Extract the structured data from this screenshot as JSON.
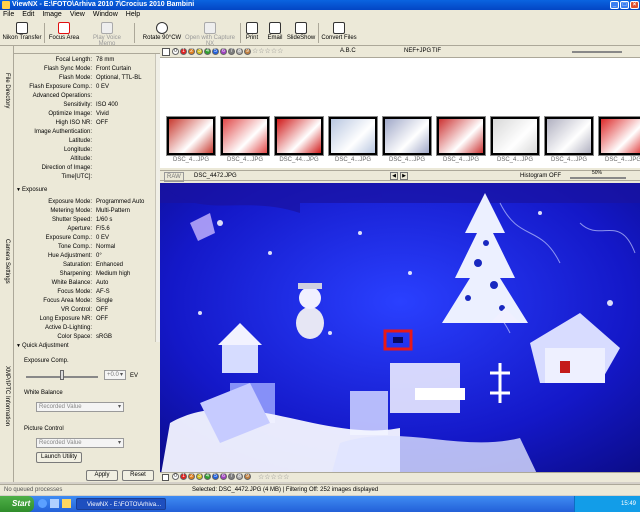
{
  "window": {
    "title": "ViewNX - E:\\FOTO\\Arhiva 2010 7\\Crocius 2010 Bambini"
  },
  "menu": [
    "File",
    "Edit",
    "Image",
    "View",
    "Window",
    "Help"
  ],
  "toolbar": {
    "nikon_transfer": "Nikon Transfer",
    "focus_area": "Focus Area",
    "play_voice_memo": "Play Voice Memo",
    "rotate": "Rotate 90°CW",
    "open_capture": "Open with Capture NX",
    "print": "Print",
    "email": "Email",
    "slideshow": "SlideShow",
    "convert": "Convert Files"
  },
  "side_tabs": {
    "file_directory": "File Directory",
    "camera_settings": "Camera Settings",
    "xmp_iptc": "XMP/IPTC Information"
  },
  "info_rows": [
    {
      "k": "Focal Length:",
      "v": "78 mm"
    },
    {
      "k": "Flash Sync Mode:",
      "v": "Front Curtain"
    },
    {
      "k": "Flash Mode:",
      "v": "Optional, TTL-BL"
    },
    {
      "k": "Flash Exposure Comp.:",
      "v": "0 EV"
    },
    {
      "k": "Advanced Operations:",
      "v": ""
    },
    {
      "k": "Sensitivity:",
      "v": "ISO 400"
    },
    {
      "k": "Optimize Image:",
      "v": "Vivid"
    },
    {
      "k": "High ISO NR:",
      "v": "OFF"
    },
    {
      "k": "Image Authentication:",
      "v": ""
    },
    {
      "k": "Latitude:",
      "v": ""
    },
    {
      "k": "Longitude:",
      "v": ""
    },
    {
      "k": "Altitude:",
      "v": ""
    },
    {
      "k": "Direction of Image:",
      "v": ""
    },
    {
      "k": "Time[UTC]:",
      "v": ""
    }
  ],
  "exposure_section": "Exposure",
  "exposure_rows": [
    {
      "k": "Exposure Mode:",
      "v": "Programmed Auto"
    },
    {
      "k": "Metering Mode:",
      "v": "Multi-Pattern"
    },
    {
      "k": "Shutter Speed:",
      "v": "1/60 s"
    },
    {
      "k": "Aperture:",
      "v": "F/5.6"
    },
    {
      "k": "Exposure Comp.:",
      "v": "0 EV"
    },
    {
      "k": "Tone Comp.:",
      "v": "Normal"
    },
    {
      "k": "Hue Adjustment:",
      "v": "0°"
    },
    {
      "k": "Saturation:",
      "v": "Enhanced"
    },
    {
      "k": "Sharpening:",
      "v": "Medium high"
    },
    {
      "k": "White Balance:",
      "v": "Auto"
    },
    {
      "k": "Focus Mode:",
      "v": "AF-S"
    },
    {
      "k": "Focus Area Mode:",
      "v": "Single"
    },
    {
      "k": "VR Control:",
      "v": "OFF"
    },
    {
      "k": "Long Exposure NR:",
      "v": "OFF"
    },
    {
      "k": "Active D-Lighting:",
      "v": ""
    },
    {
      "k": "Color Space:",
      "v": "sRGB"
    }
  ],
  "quick_adjustment": {
    "title": "Quick Adjustment",
    "exposure_comp_label": "Exposure Comp.",
    "exposure_value": "+0.0",
    "ev": "EV",
    "white_balance_label": "White Balance",
    "white_balance_value": "Recorded Value",
    "picture_control_label": "Picture Control",
    "picture_control_value": "Recorded Value",
    "launch_utility": "Launch Utility",
    "apply": "Apply",
    "reset": "Reset"
  },
  "filter": {
    "abc": "A.B.C",
    "format": "NEF+JPG",
    "tif": "TIF"
  },
  "thumbnails": [
    "DSC_4...JPG",
    "DSC_4...JPG",
    "DSC_44...JPG",
    "DSC_4...JPG",
    "DSC_4...JPG",
    "DSC_4...JPG",
    "DSC_4...JPG",
    "DSC_4...JPG",
    "DSC_4...JPG"
  ],
  "thumb_colors": [
    "#c83a30",
    "#e04848",
    "#d01a1a",
    "#b8c6e0",
    "#a0a8c8",
    "#cc3333",
    "#d8d8d8",
    "#b0b0c0",
    "#dd2a2a"
  ],
  "viewer": {
    "raw": "RAW",
    "filename": "DSC_4472.JPG",
    "histogram": "Histogram OFF",
    "zoom": "50%"
  },
  "label_dots": [
    "0",
    "1",
    "2",
    "3",
    "4",
    "5",
    "6",
    "7",
    "8",
    "9"
  ],
  "status": {
    "queue": "No queued processes",
    "selected": "Selected: DSC_4472.JPG (4 MB) | Filtering Off: 252 images displayed"
  },
  "taskbar": {
    "start": "Start",
    "item": "ViewNX - E:\\FOTO\\Arhiva...",
    "time": "15:49"
  }
}
